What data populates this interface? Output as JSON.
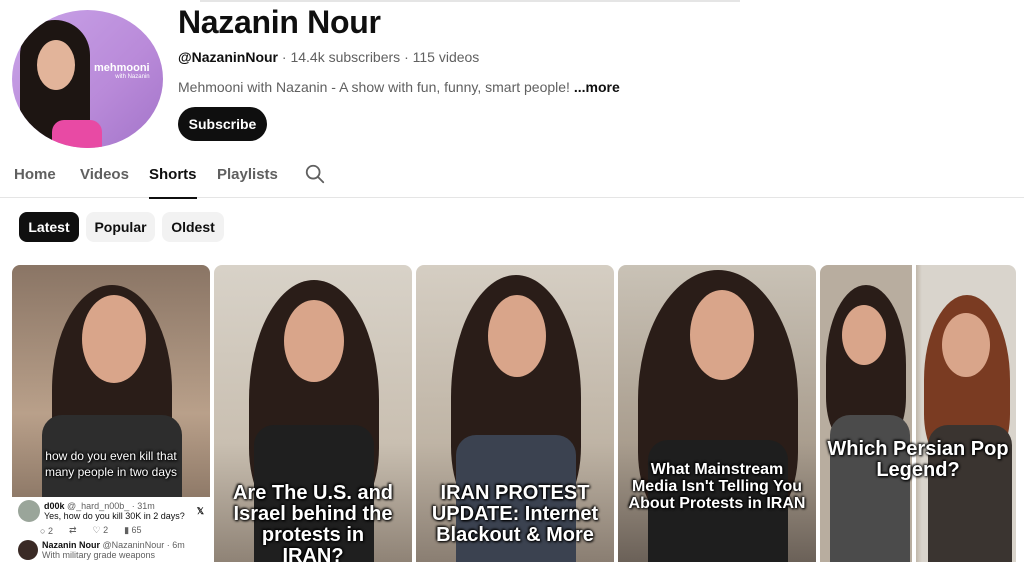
{
  "channel": {
    "name": "Nazanin Nour",
    "handle": "@NazaninNour",
    "subscribers": "14.4k subscribers",
    "videos": "115 videos",
    "description": "Mehmooni with Nazanin - A show with fun, funny, smart people!",
    "more": "...more",
    "subscribe_label": "Subscribe",
    "avatar_brand": "mehmooni",
    "avatar_brand_sub": "with Nazanin",
    "separator": "·"
  },
  "tabs": [
    {
      "label": "Home"
    },
    {
      "label": "Videos"
    },
    {
      "label": "Shorts",
      "active": true
    },
    {
      "label": "Playlists"
    }
  ],
  "search_icon": "search-icon",
  "chips": [
    {
      "label": "Latest",
      "active": true
    },
    {
      "label": "Popular"
    },
    {
      "label": "Oldest"
    }
  ],
  "shorts": [
    {
      "caption": "how do you even kill that many people in two days",
      "tweet": {
        "user": "d00k",
        "handle": "@_hard_n00b_",
        "time": "· 31m",
        "text": "Yes, how do you kill 30K in 2 days?",
        "replies": "2",
        "likes": "2",
        "views": "65",
        "reply_user": "Nazanin Nour",
        "reply_handle": "@NazaninNour",
        "reply_time": "· 6m",
        "reply_text": "With military grade weapons"
      }
    },
    {
      "caption": "Are The U.S. and Israel behind the protests in IRAN?"
    },
    {
      "caption": "IRAN PROTEST UPDATE: Internet Blackout & More"
    },
    {
      "caption": "What Mainstream Media Isn't Telling You About Protests in IRAN"
    },
    {
      "caption": "Which Persian Pop Legend?"
    }
  ],
  "colors": {
    "primary_text": "#0f0f0f",
    "secondary_text": "#606060",
    "chip_bg": "#f2f2f2",
    "avatar_bg": "#b98ad9"
  }
}
